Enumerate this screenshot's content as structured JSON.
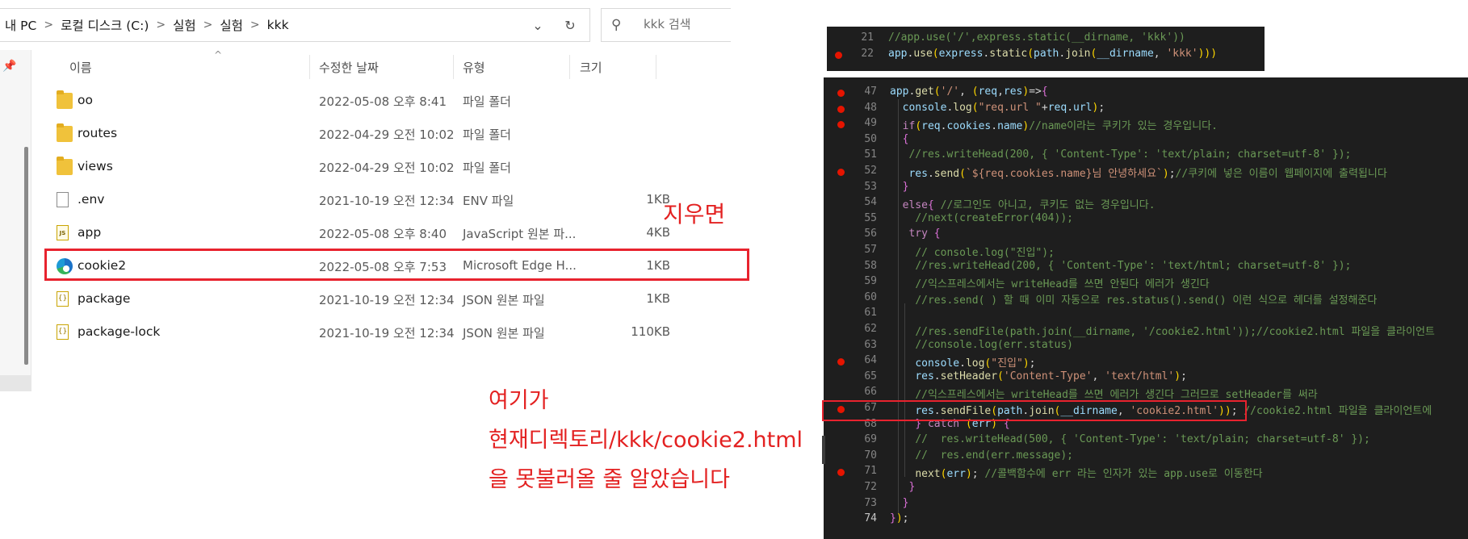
{
  "explorer": {
    "breadcrumb": [
      "내 PC",
      "로컬 디스크 (C:)",
      "실험",
      "실험",
      "kkk"
    ],
    "search_placeholder": "kkk 검색",
    "columns": {
      "name": "이름",
      "date": "수정한 날짜",
      "type": "유형",
      "size": "크기"
    },
    "files": [
      {
        "name": "oo",
        "date": "2022-05-08 오후 8:41",
        "type": "파일 폴더",
        "size": "",
        "icon": "folder-icon"
      },
      {
        "name": "routes",
        "date": "2022-04-29 오전 10:02",
        "type": "파일 폴더",
        "size": "",
        "icon": "folder-icon"
      },
      {
        "name": "views",
        "date": "2022-04-29 오전 10:02",
        "type": "파일 폴더",
        "size": "",
        "icon": "folder-icon"
      },
      {
        "name": ".env",
        "date": "2021-10-19 오전 12:34",
        "type": "ENV 파일",
        "size": "1KB",
        "icon": "file-icon"
      },
      {
        "name": "app",
        "date": "2022-05-08 오후 8:40",
        "type": "JavaScript 원본 파...",
        "size": "4KB",
        "icon": "js-file-icon"
      },
      {
        "name": "cookie2",
        "date": "2022-05-08 오후 7:53",
        "type": "Microsoft Edge H...",
        "size": "1KB",
        "icon": "edge-html-icon"
      },
      {
        "name": "package",
        "date": "2021-10-19 오전 12:34",
        "type": "JSON 원본 파일",
        "size": "1KB",
        "icon": "json-file-icon"
      },
      {
        "name": "package-lock",
        "date": "2021-10-19 오전 12:34",
        "type": "JSON 원본 파일",
        "size": "110KB",
        "icon": "json-file-icon"
      }
    ]
  },
  "annotations": {
    "delete_note": "지우면",
    "note_lines": [
      "여기가",
      "현재디렉토리/kkk/cookie2.html",
      "을 못불러올 줄 알았습니다"
    ]
  },
  "code_top": {
    "lines": [
      {
        "num": "21",
        "breakpoint": false,
        "text": "//app.use('/',express.static(__dirname, 'kkk'))"
      },
      {
        "num": "22",
        "breakpoint": true,
        "text": "app.use(express.static(path.join(__dirname, 'kkk')))"
      }
    ]
  },
  "code_main": {
    "lines": [
      {
        "num": "47",
        "breakpoint": true,
        "text": "app.get('/', (req,res)=>{"
      },
      {
        "num": "48",
        "breakpoint": true,
        "text": "  console.log(\"req.url \"+req.url);"
      },
      {
        "num": "49",
        "breakpoint": true,
        "text": "  if(req.cookies.name)//name이라는 쿠키가 있는 경우입니다."
      },
      {
        "num": "50",
        "breakpoint": false,
        "text": "  {"
      },
      {
        "num": "51",
        "breakpoint": false,
        "text": "   //res.writeHead(200, { 'Content-Type': 'text/plain; charset=utf-8' });"
      },
      {
        "num": "52",
        "breakpoint": true,
        "text": "   res.send(`${req.cookies.name}님 안녕하세요`);//쿠키에 넣은 이름이 웹페이지에 출력됩니다"
      },
      {
        "num": "53",
        "breakpoint": false,
        "text": "  }"
      },
      {
        "num": "54",
        "breakpoint": false,
        "text": "  else{ //로그인도 아니고, 쿠키도 없는 경우입니다."
      },
      {
        "num": "55",
        "breakpoint": false,
        "text": "    //next(createError(404));"
      },
      {
        "num": "56",
        "breakpoint": false,
        "text": "   try {"
      },
      {
        "num": "57",
        "breakpoint": false,
        "text": "    // console.log(\"진입\");"
      },
      {
        "num": "58",
        "breakpoint": false,
        "text": "    //res.writeHead(200, { 'Content-Type': 'text/html; charset=utf-8' });"
      },
      {
        "num": "59",
        "breakpoint": false,
        "text": "    //익스프레스에서는 writeHead를 쓰면 안된다 에러가 생긴다"
      },
      {
        "num": "60",
        "breakpoint": false,
        "text": "    //res.send( ) 할 때 이미 자동으로 res.status().send() 이런 식으로 헤더를 설정해준다"
      },
      {
        "num": "61",
        "breakpoint": false,
        "text": ""
      },
      {
        "num": "62",
        "breakpoint": false,
        "text": "    //res.sendFile(path.join(__dirname, '/cookie2.html'));//cookie2.html 파일을 클라이언트"
      },
      {
        "num": "63",
        "breakpoint": false,
        "text": "    //console.log(err.status)"
      },
      {
        "num": "64",
        "breakpoint": true,
        "text": "    console.log(\"진입\");"
      },
      {
        "num": "65",
        "breakpoint": false,
        "text": "    res.setHeader('Content-Type', 'text/html');"
      },
      {
        "num": "66",
        "breakpoint": false,
        "text": "    //익스프레스에서는 writeHead를 쓰면 에러가 생긴다 그러므로 setHeader를 써라"
      },
      {
        "num": "67",
        "breakpoint": true,
        "text": "    res.sendFile(path.join(__dirname, 'cookie2.html')); //cookie2.html 파일을 클라이언트에"
      },
      {
        "num": "68",
        "breakpoint": false,
        "text": "    } catch (err) {"
      },
      {
        "num": "69",
        "breakpoint": false,
        "text": "    //  res.writeHead(500, { 'Content-Type': 'text/plain; charset=utf-8' });"
      },
      {
        "num": "70",
        "breakpoint": false,
        "text": "    //  res.end(err.message);"
      },
      {
        "num": "71",
        "breakpoint": true,
        "text": "    next(err); //콜백함수에 err 라는 인자가 있는 app.use로 이동한다"
      },
      {
        "num": "72",
        "breakpoint": false,
        "text": "   }"
      },
      {
        "num": "73",
        "breakpoint": false,
        "text": "  }"
      },
      {
        "num": "74",
        "breakpoint": false,
        "text": "});"
      }
    ]
  }
}
